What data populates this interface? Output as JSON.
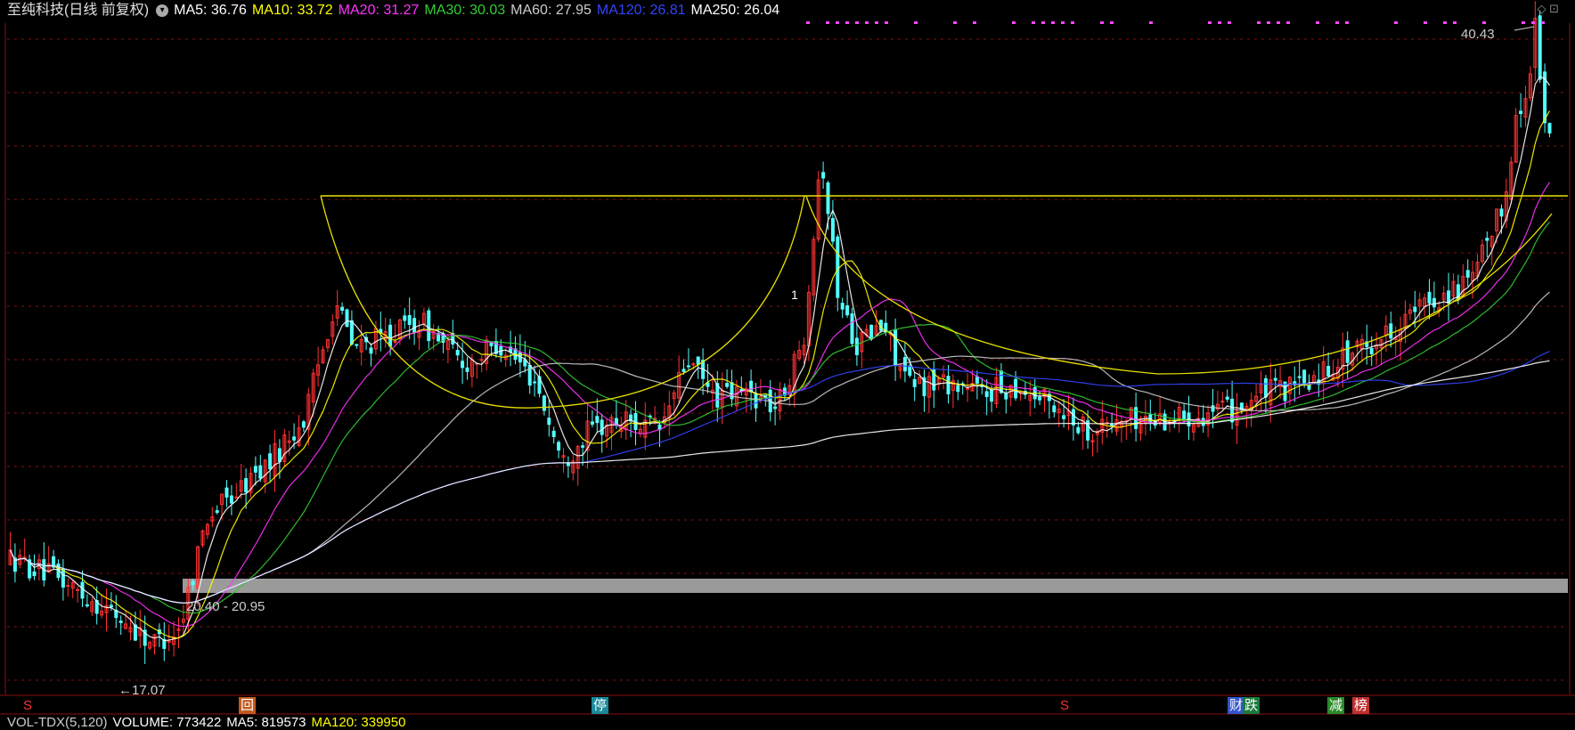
{
  "header": {
    "stock_title": "至纯科技(日线 前复权)",
    "dropdown_icon": "chevron-down-icon",
    "ma": [
      {
        "label": "MA5: 36.76",
        "color": "#ffffff"
      },
      {
        "label": "MA10: 33.72",
        "color": "#ffff00"
      },
      {
        "label": "MA20: 31.27",
        "color": "#ff33ff"
      },
      {
        "label": "MA30: 30.03",
        "color": "#33cc33"
      },
      {
        "label": "MA60: 27.95",
        "color": "#cccccc"
      },
      {
        "label": "MA120: 26.81",
        "color": "#3344ff"
      },
      {
        "label": "MA250: 26.04",
        "color": "#ffffff"
      }
    ]
  },
  "annotations": {
    "high_label": "40.43",
    "low_label": "←17.07",
    "support_band_label": "20.40 - 20.95",
    "tick_mark": "1"
  },
  "event_markers": [
    {
      "label": "S",
      "color": "#ff3030",
      "bg": "#000000"
    },
    {
      "label": "回",
      "color": "#ffffff",
      "bg": "#c05a20"
    },
    {
      "label": "停",
      "color": "#ffffff",
      "bg": "#1a8a9a"
    },
    {
      "label": "S",
      "color": "#ff3030",
      "bg": "#000000"
    },
    {
      "label": "财",
      "color": "#ffffff",
      "bg": "#3355cc"
    },
    {
      "label": "跌",
      "color": "#ffffff",
      "bg": "#1a7a3a"
    },
    {
      "label": "减",
      "color": "#ffffff",
      "bg": "#2a8a2a"
    },
    {
      "label": "榜",
      "color": "#ffffff",
      "bg": "#c03030"
    }
  ],
  "volume_header": {
    "indicator": "VOL-TDX(5,120)",
    "volume": "VOLUME: 773422",
    "ma5": "MA5: 819573",
    "ma120": "MA120: 339950"
  },
  "colors": {
    "up": "#ff3232",
    "down": "#54ffff",
    "grid": "#8a1010",
    "pattern_line": "#e8e000",
    "support_band": "#9a9a9a",
    "dotted_signal": "#ff44ff"
  },
  "chart_data": {
    "type": "candlestick",
    "price_low": 17.07,
    "price_high": 40.43,
    "support_range": [
      20.4,
      20.95
    ]
  }
}
